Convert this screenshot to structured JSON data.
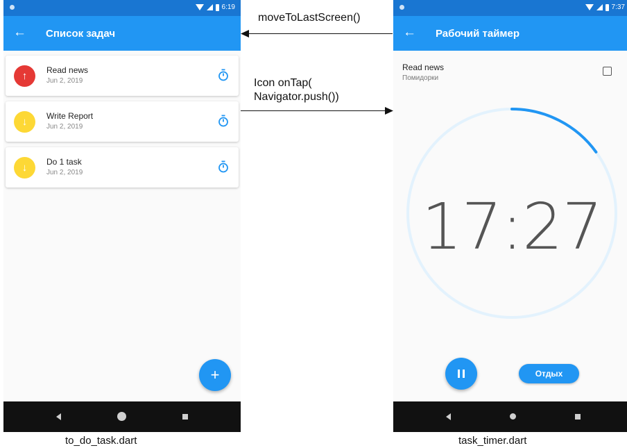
{
  "left_screen": {
    "status_time": "6:19",
    "app_bar": {
      "title": "Список задач"
    },
    "tasks": [
      {
        "title": "Read news",
        "date": "Jun 2, 2019",
        "priority": "high",
        "priority_icon": "arrow-up",
        "color": "#e53935"
      },
      {
        "title": "Write Report",
        "date": "Jun 2, 2019",
        "priority": "low",
        "priority_icon": "arrow-down",
        "color": "#fdd835"
      },
      {
        "title": "Do 1 task",
        "date": "Jun 2, 2019",
        "priority": "low",
        "priority_icon": "arrow-down",
        "color": "#fdd835"
      }
    ],
    "fab_label": "+",
    "caption": "to_do_task.dart"
  },
  "annotations": {
    "back_arrow_label": "moveToLastScreen()",
    "forward_arrow_label_line1": "Icon onTap(",
    "forward_arrow_label_line2": "Navigator.push())"
  },
  "right_screen": {
    "status_time": "7:37",
    "app_bar": {
      "title": "Рабочий таймер"
    },
    "task_title": "Read news",
    "task_subtitle": "Помидорки",
    "timer_value": "17:27",
    "timer_progress": 0.15,
    "rest_button_label": "Отдых",
    "caption": "task_timer.dart"
  },
  "colors": {
    "primary": "#2196f3",
    "status_bar": "#1976d2",
    "ring_track": "#e3f2fd",
    "high_priority": "#e53935",
    "low_priority": "#fdd835"
  }
}
